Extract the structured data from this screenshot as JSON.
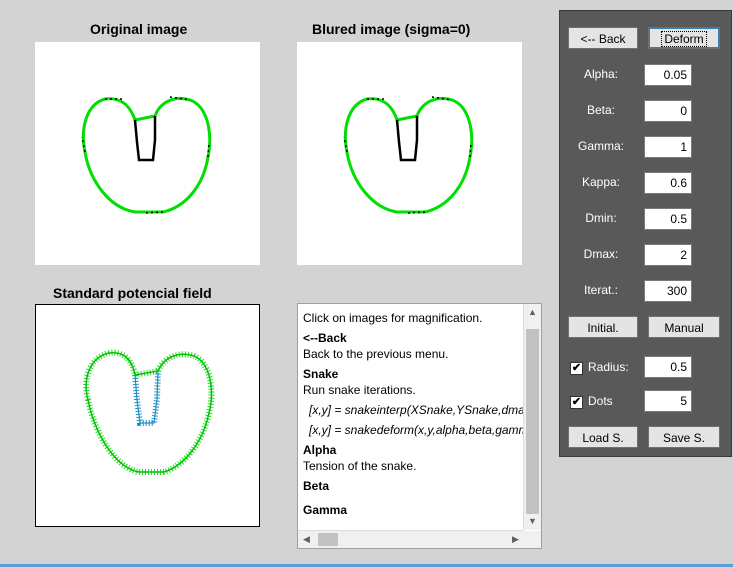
{
  "titles": {
    "original": "Original image",
    "blurred": "Blured image   (sigma=0)",
    "potential": "Standard potencial field"
  },
  "panel": {
    "back_label": "<-- Back",
    "deform_label": "Deform",
    "params": [
      {
        "label": "Alpha:",
        "value": "0.05"
      },
      {
        "label": "Beta:",
        "value": "0"
      },
      {
        "label": "Gamma:",
        "value": "1"
      },
      {
        "label": "Kappa:",
        "value": "0.6"
      },
      {
        "label": "Dmin:",
        "value": "0.5"
      },
      {
        "label": "Dmax:",
        "value": "2"
      },
      {
        "label": "Iterat.:",
        "value": "300"
      }
    ],
    "initial_label": "Initial.",
    "manual_label": "Manual",
    "radius": {
      "label": "Radius:",
      "checked": true,
      "value": "0.5"
    },
    "dots": {
      "label": "Dots",
      "checked": true,
      "value": "5"
    },
    "load_label": "Load S.",
    "save_label": "Save S."
  },
  "help": {
    "lines": [
      {
        "text": "Click on images for magnification.",
        "style": "normal"
      },
      {
        "text": "<--Back",
        "style": "bold"
      },
      {
        "text": "Back to the previous menu.",
        "style": "normal"
      },
      {
        "text": "Snake",
        "style": "bold"
      },
      {
        "text": "Run snake iterations.",
        "style": "normal"
      },
      {
        "text": "[x,y] = snakeinterp(XSnake,YSnake,dmax,",
        "style": "italic"
      },
      {
        "text": "[x,y] = snakedeform(x,y,alpha,beta,gamma",
        "style": "italic"
      },
      {
        "text": "Alpha",
        "style": "bold"
      },
      {
        "text": "Tension of the snake.",
        "style": "normal"
      },
      {
        "text": "Beta",
        "style": "bold"
      },
      {
        "text": "Gamma",
        "style": "bold"
      }
    ]
  },
  "colors": {
    "background": "#d3d3d3",
    "panel": "#595959",
    "snake": "#00e000",
    "field_arrows": "#1e8fc4",
    "accent_line": "#5a9fd6"
  },
  "icons": {
    "check": "✔",
    "up": "▲",
    "down": "▼",
    "left": "◀",
    "right": "▶"
  }
}
